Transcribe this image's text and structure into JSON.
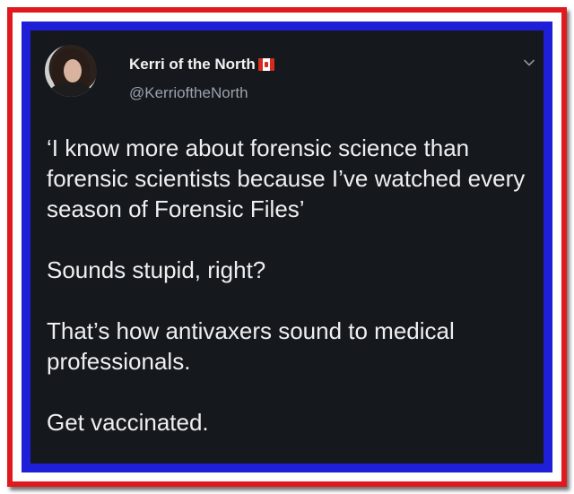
{
  "tweet": {
    "author": {
      "display_name": "Kerri of the North",
      "handle": "@KerrioftheNorth",
      "avatar_icon": "profile-photo",
      "flag_icon": "canada-flag-icon"
    },
    "menu_icon": "chevron-down-icon",
    "paragraphs": [
      "‘I know more about forensic science than forensic scientists because I’ve watched every season of Forensic Files’",
      "Sounds stupid, right?",
      "That’s how antivaxers sound to medical professionals.",
      "Get vaccinated."
    ]
  },
  "colors": {
    "frame_red": "#e0191f",
    "frame_blue": "#1f1fd8",
    "tweet_background": "#15181c",
    "text": "#eeeff0",
    "secondary_text": "#9aa3ad"
  }
}
